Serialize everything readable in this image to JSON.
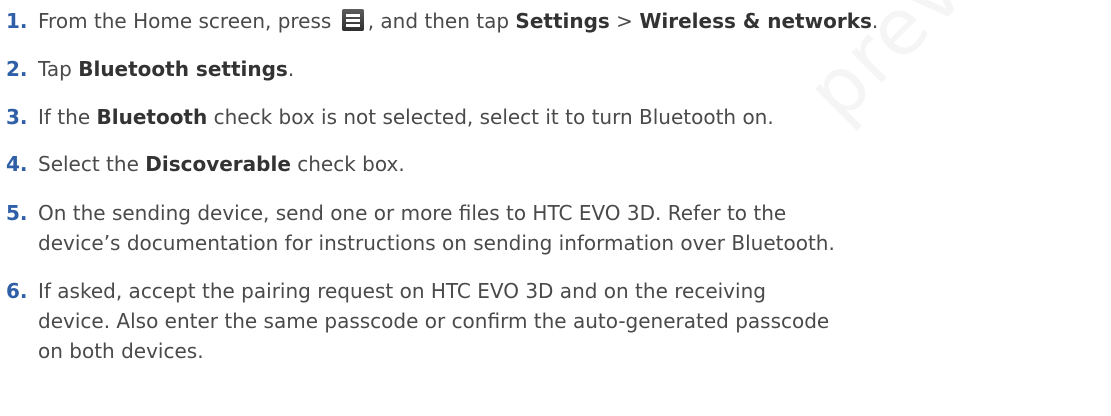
{
  "steps": [
    {
      "num": "1.",
      "parts": {
        "a": "From the Home screen, press",
        "icon": "menu-icon",
        "b": ", and then tap ",
        "c": "Settings",
        "d": " > ",
        "e": "Wireless & networks",
        "f": "."
      }
    },
    {
      "num": "2.",
      "parts": {
        "a": "Tap ",
        "b": "Bluetooth settings",
        "c": "."
      }
    },
    {
      "num": "3.",
      "parts": {
        "a": "If the ",
        "b": "Bluetooth",
        "c": " check box is not selected, select it to turn Bluetooth on."
      }
    },
    {
      "num": "4.",
      "parts": {
        "a": "Select the ",
        "b": "Discoverable",
        "c": " check box."
      }
    },
    {
      "num": "5.",
      "lines": [
        "On the sending device, send one or more files to HTC EVO 3D. Refer to the",
        "device’s documentation for instructions on sending information over Bluetooth."
      ]
    },
    {
      "num": "6.",
      "lines": [
        "If asked, accept the pairing request on HTC EVO 3D and on the receiving",
        "device. Also enter the same passcode or confirm the auto-generated passcode",
        "on both devices."
      ]
    }
  ],
  "watermark": "preview"
}
